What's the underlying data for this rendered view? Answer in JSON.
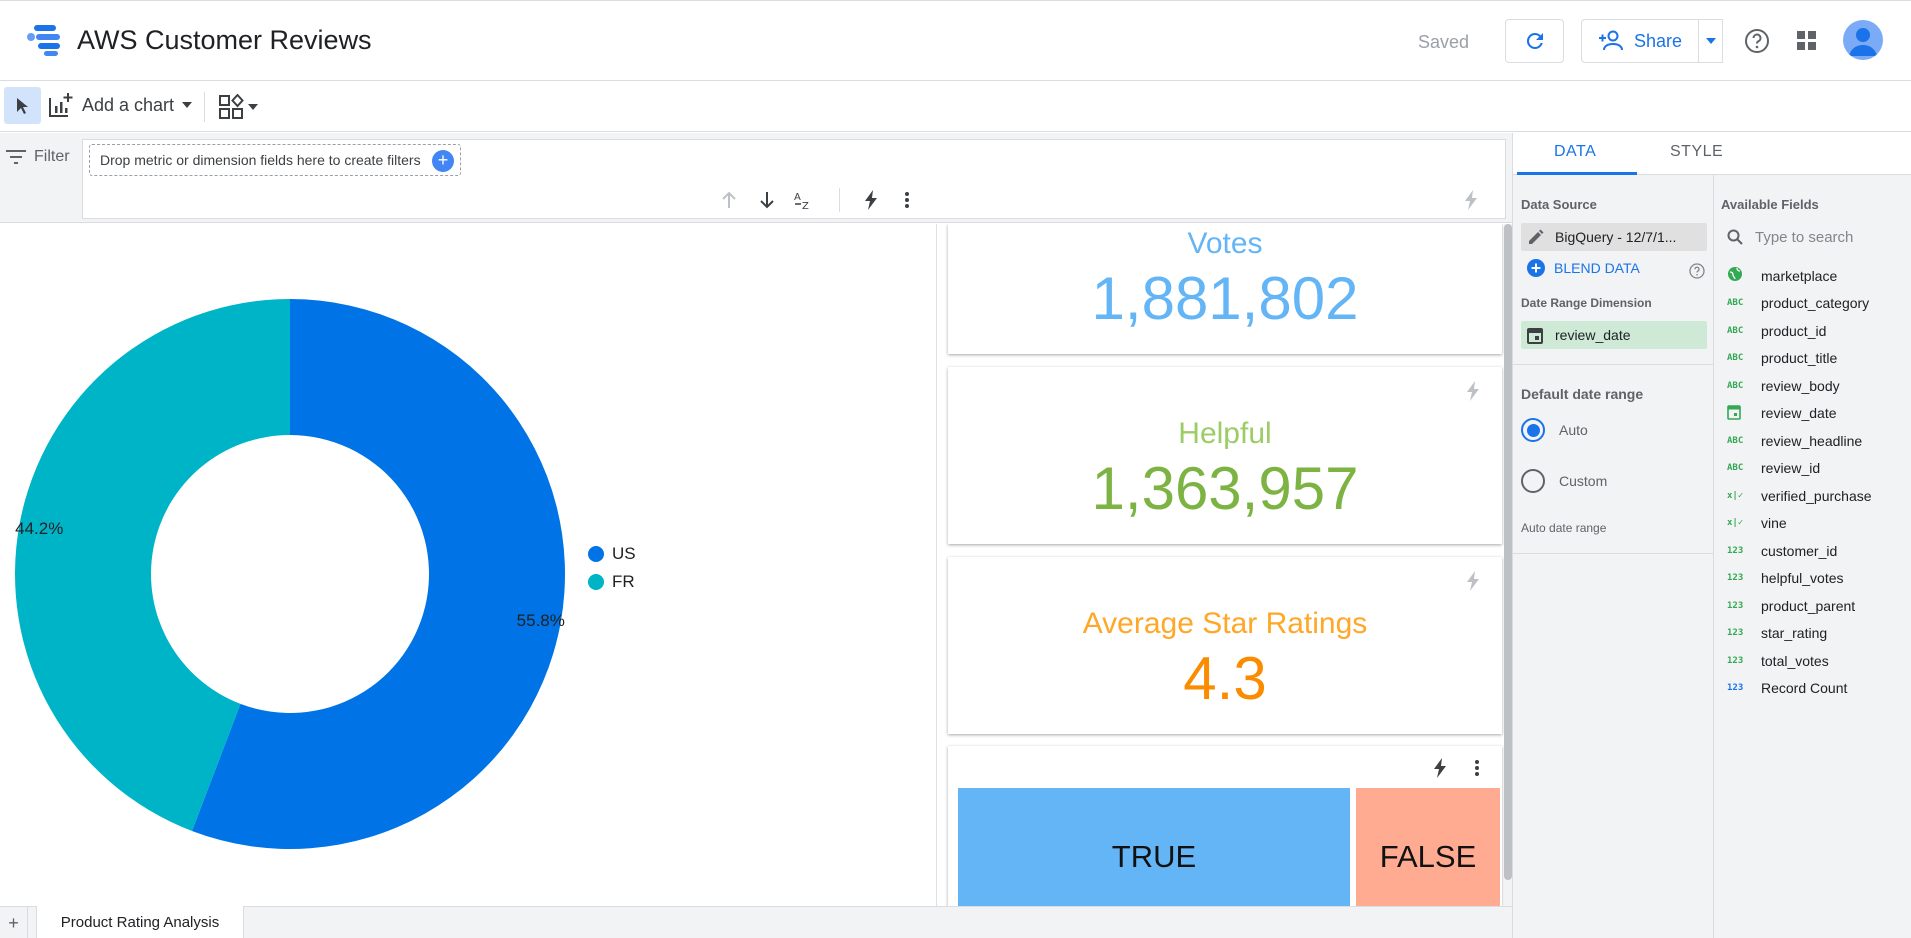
{
  "header": {
    "title": "AWS Customer Reviews",
    "saved_status": "Saved",
    "share_label": "Share"
  },
  "toolbar": {
    "add_chart_label": "Add a chart"
  },
  "filter": {
    "label": "Filter",
    "drop_hint": "Drop metric or dimension fields here to create filters"
  },
  "chart_data": {
    "type": "pie",
    "categories": [
      "US",
      "FR"
    ],
    "values": [
      55.8,
      44.2
    ],
    "labels": [
      "55.8%",
      "44.2%"
    ],
    "colors": [
      "#0073e6",
      "#00b4c8"
    ],
    "legend": "right"
  },
  "scorecards": [
    {
      "label": "Votes",
      "value": "1,881,802",
      "color": "#64b5f6"
    },
    {
      "label": "Helpful",
      "value": "1,363,957",
      "color": "#7cb342"
    },
    {
      "label": "Average Star Ratings",
      "value": "4.3",
      "color": "#fb8c00"
    }
  ],
  "treemap": {
    "true_label": "TRUE",
    "false_label": "FALSE",
    "true_color": "#64b5f6",
    "false_color": "#ffab91"
  },
  "pages": {
    "current": "Product Rating Analysis"
  },
  "panel": {
    "tabs": [
      "DATA",
      "STYLE"
    ],
    "active_tab": "DATA",
    "data_source_title": "Data Source",
    "data_source_name": "BigQuery - 12/7/1...",
    "blend_label": "BLEND DATA",
    "date_range_dimension_title": "Date Range Dimension",
    "date_range_dimension": "review_date",
    "default_date_range_title": "Default date range",
    "radio_auto": "Auto",
    "radio_custom": "Custom",
    "selected_range": "Auto",
    "auto_range_label": "Auto date range",
    "available_fields_title": "Available Fields",
    "search_placeholder": "Type to search",
    "fields": [
      {
        "name": "marketplace",
        "type": "geo"
      },
      {
        "name": "product_category",
        "type": "ABC"
      },
      {
        "name": "product_id",
        "type": "ABC"
      },
      {
        "name": "product_title",
        "type": "ABC"
      },
      {
        "name": "review_body",
        "type": "ABC"
      },
      {
        "name": "review_date",
        "type": "date"
      },
      {
        "name": "review_headline",
        "type": "ABC"
      },
      {
        "name": "review_id",
        "type": "ABC"
      },
      {
        "name": "verified_purchase",
        "type": "bool"
      },
      {
        "name": "vine",
        "type": "bool"
      },
      {
        "name": "customer_id",
        "type": "123"
      },
      {
        "name": "helpful_votes",
        "type": "123"
      },
      {
        "name": "product_parent",
        "type": "123"
      },
      {
        "name": "star_rating",
        "type": "123"
      },
      {
        "name": "total_votes",
        "type": "123"
      },
      {
        "name": "Record Count",
        "type": "metric"
      }
    ]
  }
}
